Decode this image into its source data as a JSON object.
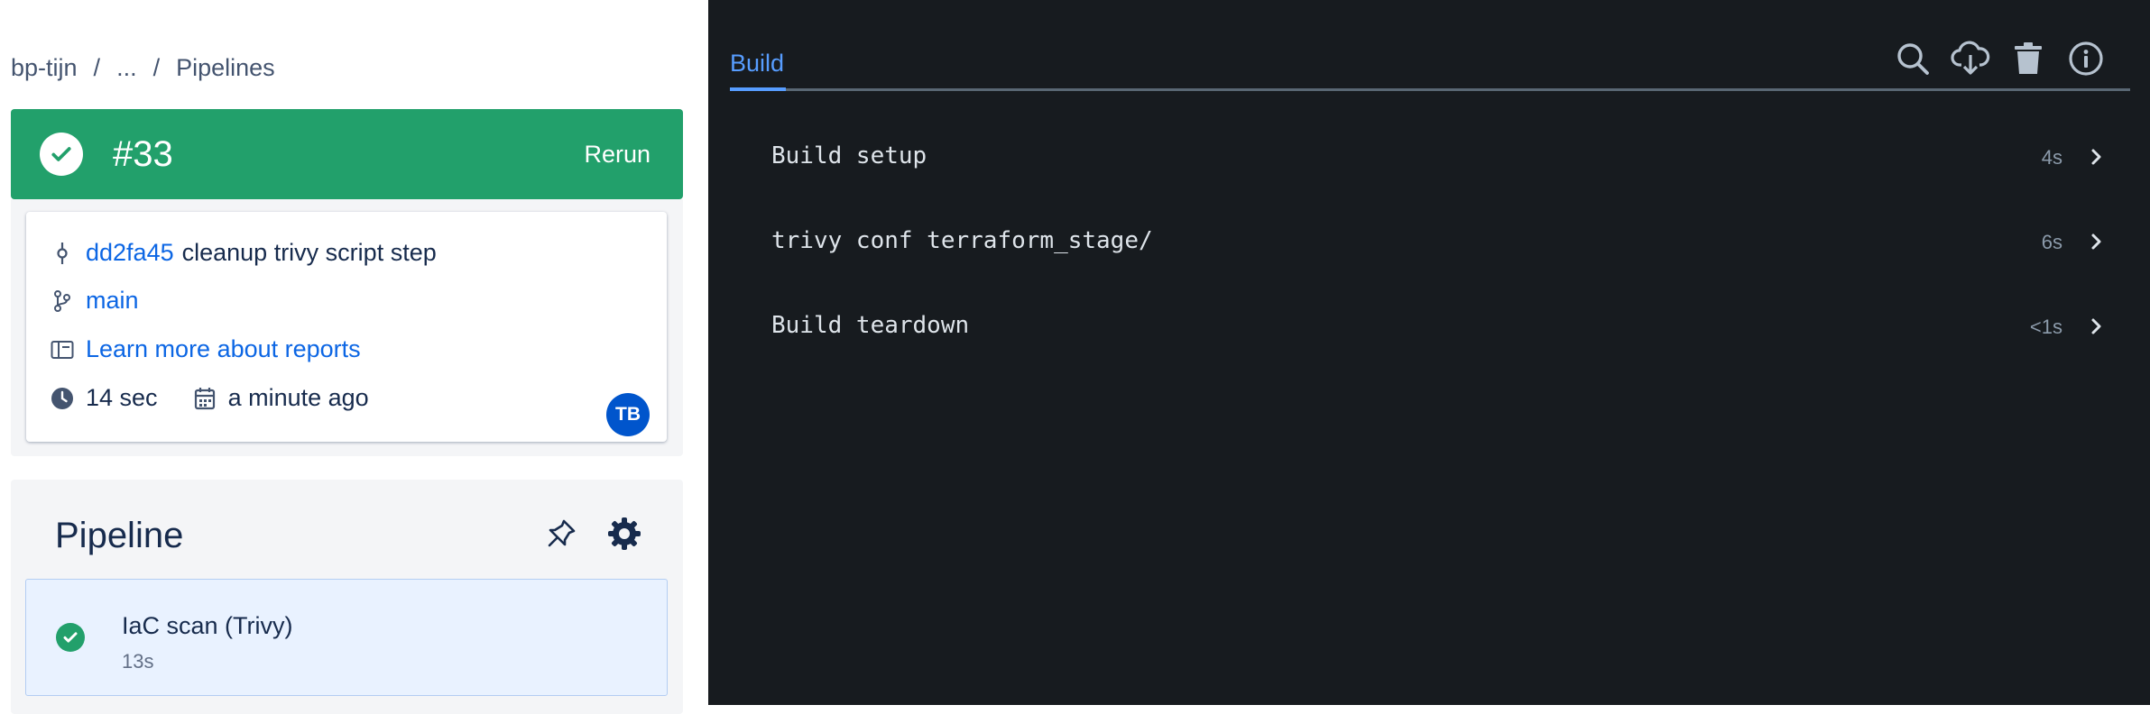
{
  "breadcrumb": {
    "items": [
      "bp-tijn",
      "...",
      "Pipelines"
    ],
    "separator": "/"
  },
  "run": {
    "status": "success",
    "number": "#33",
    "rerun_label": "Rerun"
  },
  "details": {
    "commit_hash": "dd2fa45",
    "commit_message": "cleanup trivy script step",
    "branch": "main",
    "reports_link": "Learn more about reports",
    "duration": "14 sec",
    "started": "a minute ago",
    "avatar_initials": "TB"
  },
  "pipeline": {
    "title": "Pipeline",
    "steps": [
      {
        "name": "IaC scan (Trivy)",
        "duration": "13s",
        "status": "success"
      }
    ]
  },
  "log_panel": {
    "tab": "Build",
    "tools": [
      "search-icon",
      "download-icon",
      "delete-icon",
      "info-icon"
    ],
    "rows": [
      {
        "name": "Build setup",
        "duration": "4s"
      },
      {
        "name": "trivy conf terraform_stage/",
        "duration": "6s"
      },
      {
        "name": "Build teardown",
        "duration": "<1s"
      }
    ]
  },
  "colors": {
    "success": "#22a06b",
    "link": "#0c66e4",
    "log_bg": "#171b1f",
    "tab_accent": "#579dff"
  }
}
